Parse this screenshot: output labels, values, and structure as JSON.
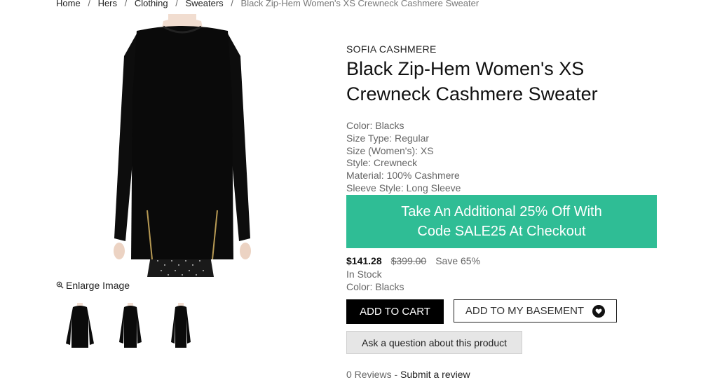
{
  "breadcrumb": {
    "items": [
      "Home",
      "Hers",
      "Clothing",
      "Sweaters"
    ],
    "current": "Black Zip-Hem Women's XS Crewneck Cashmere Sweater"
  },
  "gallery": {
    "enlarge_label": "Enlarge Image",
    "thumbnail_count": 3
  },
  "product": {
    "brand": "SOFIA CASHMERE",
    "title": "Black Zip-Hem Women's XS Crewneck Cashmere Sweater",
    "attributes": [
      "Color: Blacks",
      "Size Type: Regular",
      "Size (Women's): XS",
      "Style: Crewneck",
      "Material: 100% Cashmere",
      "Sleeve Style: Long Sleeve"
    ]
  },
  "promo": {
    "line1": "Take An Additional 25% Off With",
    "line2": "Code SALE25 At Checkout",
    "color": "#2fbd95"
  },
  "pricing": {
    "price": "$141.28",
    "original": "$399.00",
    "save": "Save 65%",
    "stock": "In Stock",
    "color": "Color: Blacks"
  },
  "actions": {
    "add_to_cart": "ADD TO CART",
    "add_to_basement": "ADD TO MY BASEMENT",
    "ask_question": "Ask a question about this product"
  },
  "reviews": {
    "count_text": "0 Reviews",
    "separator": " - ",
    "submit": "Submit a review"
  }
}
